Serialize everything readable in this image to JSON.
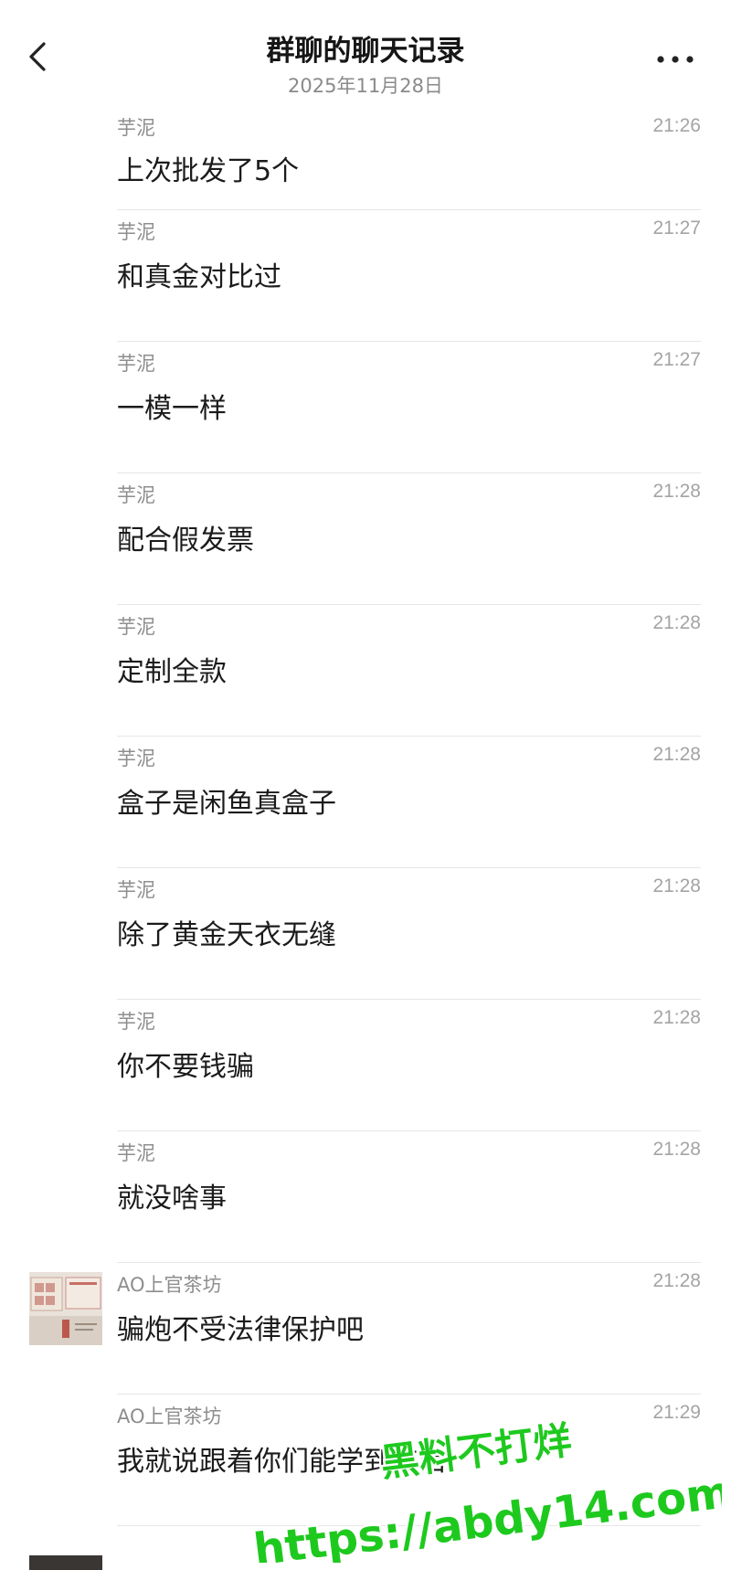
{
  "header": {
    "title": "群聊的聊天记录",
    "date": "2025年11月28日",
    "back_icon": "chevron-left-icon",
    "more_icon": "more-horizontal-icon"
  },
  "messages": [
    {
      "sender": "芋泥",
      "time": "21:26",
      "text": "上次批发了5个"
    },
    {
      "sender": "芋泥",
      "time": "21:27",
      "text": "和真金对比过"
    },
    {
      "sender": "芋泥",
      "time": "21:27",
      "text": "一模一样"
    },
    {
      "sender": "芋泥",
      "time": "21:28",
      "text": "配合假发票"
    },
    {
      "sender": "芋泥",
      "time": "21:28",
      "text": "定制全款"
    },
    {
      "sender": "芋泥",
      "time": "21:28",
      "text": "盒子是闲鱼真盒子"
    },
    {
      "sender": "芋泥",
      "time": "21:28",
      "text": "除了黄金天衣无缝"
    },
    {
      "sender": "芋泥",
      "time": "21:28",
      "text": "你不要钱骗"
    },
    {
      "sender": "芋泥",
      "time": "21:28",
      "text": "就没啥事"
    },
    {
      "sender": "AO上官茶坊",
      "time": "21:28",
      "text": "骗炮不受法律保护吧",
      "has_avatar": true
    },
    {
      "sender": "AO上官茶坊",
      "time": "21:29",
      "text": "我就说跟着你们能学到东西"
    }
  ],
  "watermark": {
    "line1": "黑料不打烊",
    "line2": "https://abdy14.com",
    "color": "#1ec91e"
  }
}
